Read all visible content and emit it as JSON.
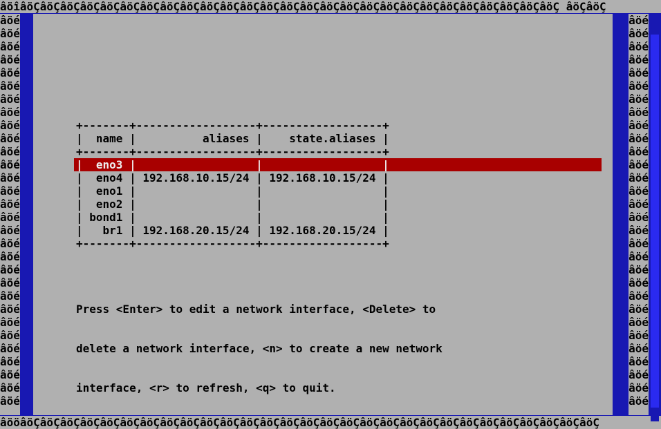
{
  "border": {
    "top": "âöîâöÇâöÇâöÇâöÇâöÇâöÇâöÇâöÇâöÇâöÇâöÇâöÇâöÇâöÇâöÇâöÇâöÇâöÇâöÇâöÇâöÇâöÇâöÇâöÇâöÇâöÇâöÇ âöÇâöÇ",
    "bottom": "âööâöÇâöÇâöÇâöÇâöÇâöÇâöÇâöÇâöÇâöÇâöÇâöÇâöÇâöÇâöÇâöÇâöÇâöÇâöÇâöÇâöÇâöÇâöÇâöÇâöÇâöÇâöÇâöÇâöÇ",
    "side": "âöé"
  },
  "table": {
    "border_top": "+-------+------------------+------------------+",
    "header_row": "|  name |          aliases |    state.aliases |",
    "border_mid": "+-------+------------------+------------------+",
    "rows": [
      {
        "name": "eno3",
        "aliases": "",
        "state_aliases": "",
        "selected": true
      },
      {
        "name": "eno4",
        "aliases": "192.168.10.15/24",
        "state_aliases": "192.168.10.15/24",
        "selected": false
      },
      {
        "name": "eno1",
        "aliases": "",
        "state_aliases": "",
        "selected": false
      },
      {
        "name": "eno2",
        "aliases": "",
        "state_aliases": "",
        "selected": false
      },
      {
        "name": "bond1",
        "aliases": "",
        "state_aliases": "",
        "selected": false
      },
      {
        "name": "br1",
        "aliases": "192.168.20.15/24",
        "state_aliases": "192.168.20.15/24",
        "selected": false
      }
    ],
    "border_bot": "+-------+------------------+------------------+"
  },
  "help": {
    "line1": "Press <Enter> to edit a network interface, <Delete> to",
    "line2": "delete a network interface, <n> to create a new network",
    "line3": "interface, <r> to refresh, <q> to quit."
  }
}
